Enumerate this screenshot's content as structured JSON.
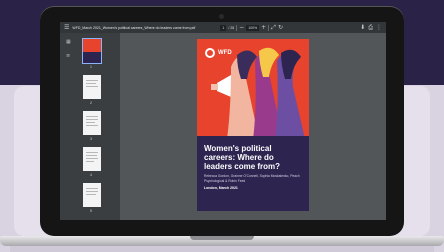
{
  "viewer": {
    "menu_icon": "menu-icon",
    "file_title": "WFD_March 2021_Women's political careers_Where do leaders come from.pdf",
    "page_current": "1",
    "page_total": "/ 28",
    "zoom": "100%",
    "download_icon": "download-icon",
    "print_icon": "print-icon",
    "more_icon": "more-vert-icon"
  },
  "sidebar": {
    "thumbnails": [
      {
        "label": "1"
      },
      {
        "label": "2"
      },
      {
        "label": "3"
      },
      {
        "label": "4"
      },
      {
        "label": "5"
      }
    ]
  },
  "document": {
    "logo_text": "WFD",
    "title": "Women's political careers: Where do leaders come from?",
    "authors": "Rebecca Gordon, Grainne O'Connell, Sophia Moskalenko, Peach Psychological & Robin Feed",
    "place_date": "London, March 2021"
  },
  "colors": {
    "cover_red": "#e8432d",
    "cover_navy": "#2d2550",
    "background_purple": "#2b2347",
    "viewer_grey": "#525659"
  }
}
